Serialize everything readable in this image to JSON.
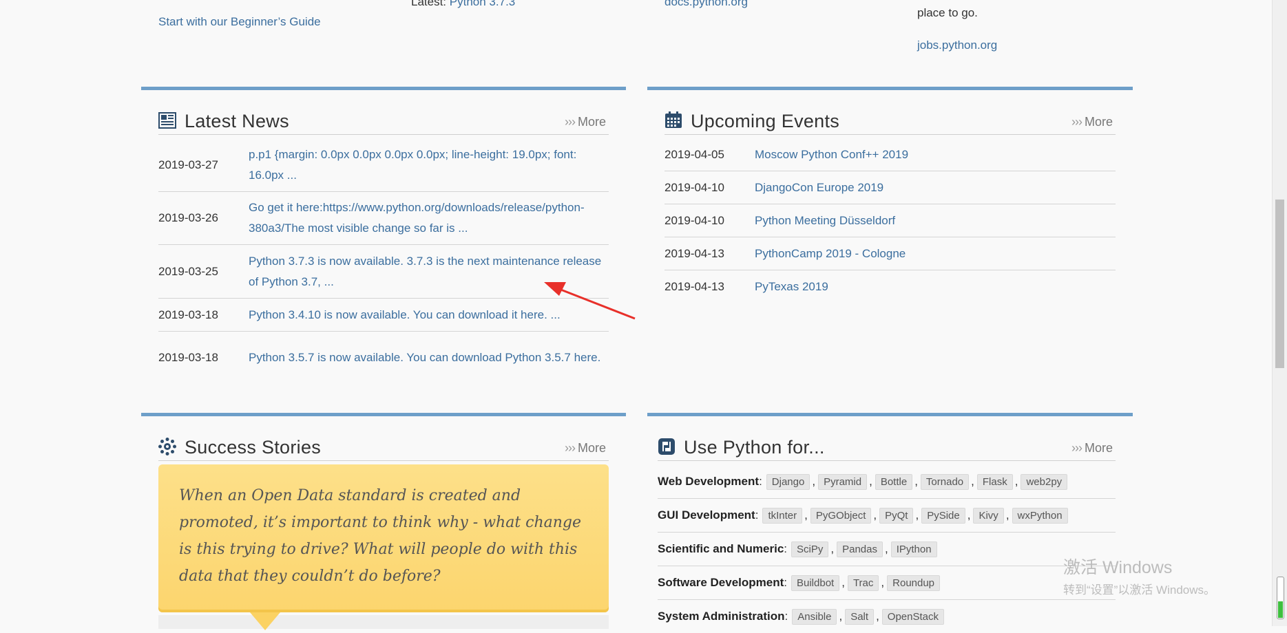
{
  "top": {
    "beginner_link": "Start with our Beginner’s Guide",
    "latest_label": "Latest:",
    "latest_link": "Python 3.7.3",
    "docs_link": "docs.python.org",
    "place_text": "place to go.",
    "jobs_link": "jobs.python.org"
  },
  "news": {
    "title": "Latest News",
    "more": "More",
    "more_chevrons": "›››",
    "items": [
      {
        "date": "2019-03-27",
        "text": "p.p1 {margin: 0.0px 0.0px 0.0px 0.0px; line-height: 19.0px; font: 16.0px ..."
      },
      {
        "date": "2019-03-26",
        "text": "Go get it here:https://www.python.org/downloads/release/python-380a3/The most visible change so far is ..."
      },
      {
        "date": "2019-03-25",
        "text": "Python 3.7.3 is now available. 3.7.3 is the next maintenance release of Python 3.7, ..."
      },
      {
        "date": "2019-03-18",
        "text": "Python 3.4.10 is now available.  You can download it here. ..."
      },
      {
        "date": "2019-03-18",
        "text": "Python 3.5.7 is now available.  You can download Python 3.5.7 here."
      }
    ]
  },
  "events": {
    "title": "Upcoming Events",
    "more": "More",
    "more_chevrons": "›››",
    "items": [
      {
        "date": "2019-04-05",
        "text": "Moscow Python Conf++ 2019"
      },
      {
        "date": "2019-04-10",
        "text": "DjangoCon Europe 2019"
      },
      {
        "date": "2019-04-10",
        "text": "Python Meeting Düsseldorf"
      },
      {
        "date": "2019-04-13",
        "text": "PythonCamp 2019 - Cologne"
      },
      {
        "date": "2019-04-13",
        "text": "PyTexas 2019"
      }
    ]
  },
  "stories": {
    "title": "Success Stories",
    "more": "More",
    "more_chevrons": "›››",
    "quote": "When an Open Data standard is created and promoted, it’s important to think why - what change is this trying to drive? What will people do with this data that they couldn’t do before?"
  },
  "usefor": {
    "title": "Use Python for...",
    "more": "More",
    "more_chevrons": "›››",
    "rows": [
      {
        "category": "Web Development",
        "tags": [
          "Django",
          "Pyramid",
          "Bottle",
          "Tornado",
          "Flask",
          "web2py"
        ]
      },
      {
        "category": "GUI Development",
        "tags": [
          "tkInter",
          "PyGObject",
          "PyQt",
          "PySide",
          "Kivy",
          "wxPython"
        ]
      },
      {
        "category": "Scientific and Numeric",
        "tags": [
          "SciPy",
          "Pandas",
          "IPython"
        ]
      },
      {
        "category": "Software Development",
        "tags": [
          "Buildbot",
          "Trac",
          "Roundup"
        ]
      },
      {
        "category": "System Administration",
        "tags": [
          "Ansible",
          "Salt",
          "OpenStack"
        ]
      }
    ]
  },
  "watermark": {
    "line1": "激活 Windows",
    "line2": "转到“设置”以激活 Windows。"
  },
  "colors": {
    "accent_border": "#6e9fc9",
    "link": "#3b6e9e",
    "quote_bg": "#fcd56e",
    "annotation_arrow": "#e8302a"
  }
}
